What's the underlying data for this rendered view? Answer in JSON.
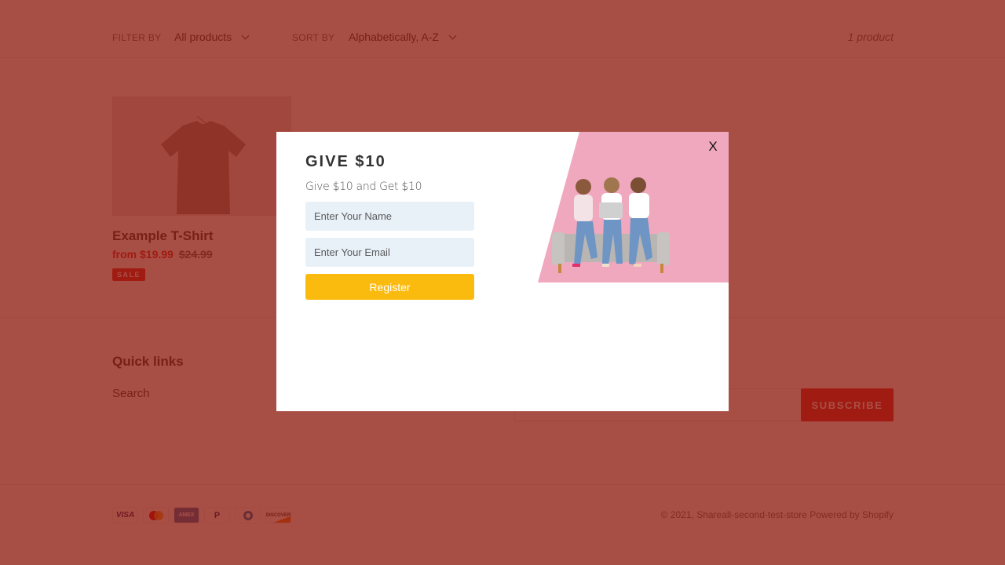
{
  "toolbar": {
    "filter_label": "FILTER BY",
    "filter_value": "All products",
    "sort_label": "SORT BY",
    "sort_value": "Alphabetically, A-Z",
    "product_count": "1 product"
  },
  "products": [
    {
      "title": "Example T-Shirt",
      "price": "from $19.99",
      "compare_price": "$24.99",
      "badge": "SALE",
      "image_icon": "tshirt-image"
    }
  ],
  "footer": {
    "quick_links_title": "Quick links",
    "quick_links": [
      "Search"
    ],
    "newsletter": {
      "email_placeholder": "",
      "subscribe_label": "SUBSCRIBE"
    },
    "payment_icons": [
      "visa",
      "mastercard",
      "amex",
      "paypal",
      "diners-club",
      "discover"
    ],
    "payment_labels": {
      "visa": "VISA",
      "amex": "AMEX",
      "paypal": "P",
      "discover": "DISCOVER"
    },
    "copyright_prefix": "© 2021, ",
    "store_name": "Shareall-second-test-store",
    "powered_by": "Powered by Shopify"
  },
  "modal": {
    "title": "GIVE $10",
    "subtitle": "Give $10 and Get $10",
    "name_placeholder": "Enter Your Name",
    "email_placeholder": "Enter Your Email",
    "register_label": "Register",
    "close_label": "X",
    "hero_image": "three-women-on-sofa-with-laptop"
  },
  "colors": {
    "overlay": "#8b170a",
    "sale_red": "#e02b2b",
    "register_yellow": "#fbbb0e",
    "input_bg": "#e8f0f8",
    "hero_pink": "#f0a8bf"
  }
}
